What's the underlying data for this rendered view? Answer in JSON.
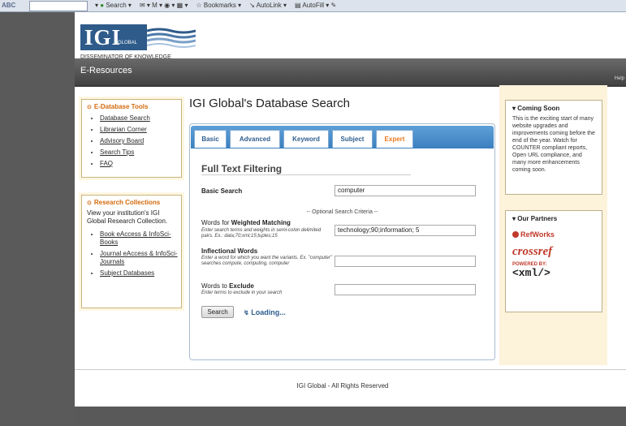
{
  "toolbar": {
    "search_label": "Search",
    "bookmarks_label": "Bookmarks",
    "autolink_label": "AutoLink",
    "autofill_label": "AutoFill"
  },
  "logo": {
    "text": "IGI",
    "global": "GLOBAL",
    "tagline": "DISSEMINATOR OF KNOWLEDGE"
  },
  "navbar": {
    "title": "E-Resources",
    "right_text": "Help"
  },
  "left": {
    "tools": {
      "title": "E-Database Tools",
      "items": [
        "Database Search",
        "Librarian Corner",
        "Advisory Board",
        "Search Tips",
        "FAQ"
      ]
    },
    "collections": {
      "title": "Research Collections",
      "intro": "View your institution's IGI Global Research Collection.",
      "items": [
        "Book eAccess & InfoSci-Books",
        "Journal eAccess & InfoSci-Journals",
        "Subject Databases"
      ]
    }
  },
  "main": {
    "title": "IGI Global's Database Search",
    "tabs": [
      "Basic",
      "Advanced",
      "Keyword",
      "Subject",
      "Expert"
    ],
    "active_tab": "Expert",
    "section_title": "Full Text Filtering",
    "basic_search_label": "Basic Search",
    "basic_search_value": "computer",
    "optional_label": "-- Optional Search Criteria --",
    "weighted_label_prefix": "Words for ",
    "weighted_label_bold": "Weighted Matching",
    "weighted_hint": "Enter search terms and weights in semi-colon delimited pairs. Ex.: data;70;xml;15;tuples;15",
    "weighted_value": "technology;90;information; 5",
    "inflectional_label": "Inflectional Words",
    "inflectional_hint": "Enter a word for which you want the variants. Ex. \"computer\" searches compute, computing, computer",
    "inflectional_value": "",
    "exclude_label_prefix": "Words to ",
    "exclude_label_bold": "Exclude",
    "exclude_hint": "Enter terms to exclude in your search",
    "exclude_value": "",
    "search_button": "Search",
    "loading_text": "Loading..."
  },
  "right": {
    "coming_soon": {
      "title": "Coming Soon",
      "text": "This is the exciting start of many website upgrades and improvements coming before the end of the year. Watch for COUNTER compliant reports, Open URL compliance, and many more enhancements coming soon."
    },
    "partners": {
      "title": "Our Partners",
      "refworks": "RefWorks",
      "crossref": "crossref",
      "powered_by": "POWERED BY:",
      "xml": "<xml/>"
    }
  },
  "footer": {
    "text": "IGI Global - All Rights Reserved"
  },
  "colors": {
    "accent": "#e8791e",
    "tab_blue": "#3b7fbf",
    "nav": "#4a4a4a"
  }
}
